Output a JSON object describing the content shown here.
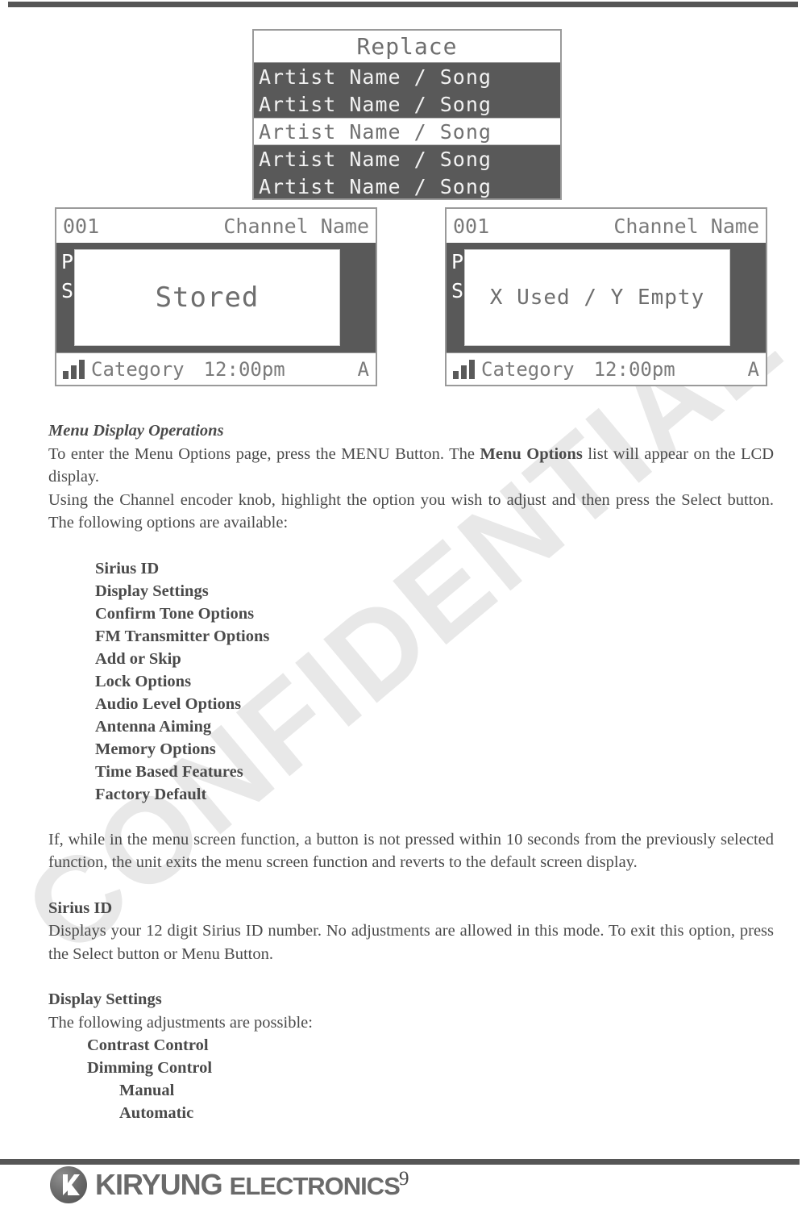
{
  "document": {
    "page_number": "9"
  },
  "watermark": {
    "text": "CONFIDENTIAL"
  },
  "replace_panel": {
    "title": "Replace",
    "items": [
      {
        "label": "Artist Name / Song",
        "selected": false
      },
      {
        "label": "Artist Name / Song",
        "selected": false
      },
      {
        "label": "Artist Name / Song",
        "selected": true
      },
      {
        "label": "Artist Name / Song",
        "selected": false
      },
      {
        "label": "Artist Name / Song",
        "selected": false
      }
    ]
  },
  "lcd_left": {
    "channel_number": "001",
    "channel_name": "Channel Name",
    "background_text": "P\nS",
    "popup_text": "Stored",
    "category": "Category",
    "time": "12:00pm",
    "band": "A"
  },
  "lcd_right": {
    "channel_number": "001",
    "channel_name": "Channel Name",
    "background_text": "P\nS",
    "popup_text": "X Used / Y Empty",
    "category": "Category",
    "time": "12:00pm",
    "band": "A"
  },
  "body": {
    "section1_heading": "Menu Display Operations",
    "para1_a": "To enter the Menu Options page, press the MENU Button. The ",
    "para1_bold": "Menu Options",
    "para1_b": " list will appear on the LCD display.",
    "para2": "Using the Channel encoder knob, highlight the option you wish to adjust and then press the Select button. The following options are available:",
    "menu_options": [
      "Sirius ID",
      "Display Settings",
      "Confirm Tone Options",
      "FM Transmitter Options",
      "Add or Skip",
      "Lock Options",
      "Audio Level Options",
      "Antenna Aiming",
      "Memory Options",
      "Time Based Features",
      "Factory Default"
    ],
    "para3": "If, while in the menu screen function, a button is not pressed within 10 seconds from the previously selected function, the unit exits the menu screen function and reverts to the default screen display.",
    "section2_heading": "Sirius ID",
    "para4": "Displays your 12 digit Sirius ID number. No adjustments are allowed in this mode. To exit this option, press the Select button or Menu Button.",
    "section3_heading": "Display Settings",
    "para5": "The following adjustments are possible:",
    "display_settings": [
      {
        "label": "Contrast Control",
        "level": 1
      },
      {
        "label": "Dimming Control",
        "level": 1
      },
      {
        "label": "Manual",
        "level": 2
      },
      {
        "label": "Automatic",
        "level": 2
      }
    ]
  },
  "footer": {
    "brand_primary": "KIRYUNG",
    "brand_secondary": "ELECTRONICS"
  },
  "colors": {
    "rule": "#565656",
    "lcd_background": "#595959",
    "lcd_foreground": "#ffffff",
    "watermark": "#e8e8e8",
    "text": "#4a4a4a"
  }
}
